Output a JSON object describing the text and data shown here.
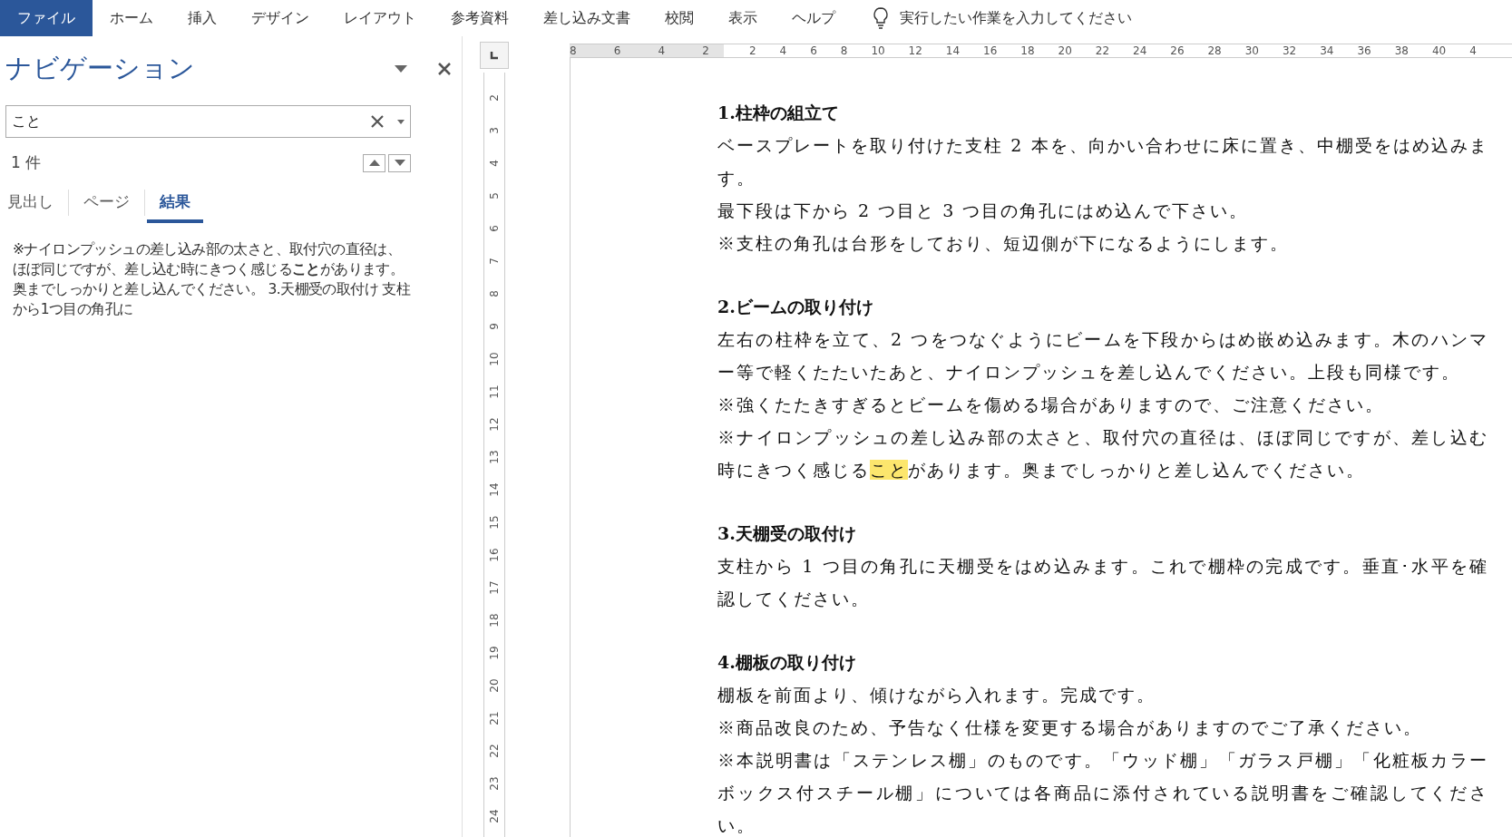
{
  "menu": [
    {
      "label": "ファイル",
      "selected": true
    },
    {
      "label": "ホーム",
      "selected": false
    },
    {
      "label": "挿入",
      "selected": false
    },
    {
      "label": "デザイン",
      "selected": false
    },
    {
      "label": "レイアウト",
      "selected": false
    },
    {
      "label": "参考資料",
      "selected": false
    },
    {
      "label": "差し込み文書",
      "selected": false
    },
    {
      "label": "校閲",
      "selected": false
    },
    {
      "label": "表示",
      "selected": false
    },
    {
      "label": "ヘルプ",
      "selected": false
    }
  ],
  "tell_me": "実行したい作業を入力してください",
  "navigation": {
    "title": "ナビゲーション",
    "search": {
      "value": "こと"
    },
    "result_count": "1 件",
    "tabs": [
      {
        "label": "見出し",
        "selected": false
      },
      {
        "label": "ページ",
        "selected": false
      },
      {
        "label": "結果",
        "selected": true
      }
    ],
    "result": "※ナイロンプッシュの差し込み部の太さと、取付穴の直径は、ほぼ同じですが、差し込む時にきつく感じる**こと**があります。奥までしっかりと差し込んでください。 3.天棚受の取付け 支柱から1つ目の角孔に"
  },
  "ruler": {
    "left_ticks": [
      "8",
      "6",
      "4",
      "2"
    ],
    "right_ticks": [
      "2",
      "4",
      "6",
      "8",
      "10",
      "12",
      "14",
      "16",
      "18",
      "20",
      "22",
      "24",
      "26",
      "28",
      "30",
      "32",
      "34",
      "36",
      "38",
      "40",
      "4"
    ],
    "vertical_ticks": [
      "2",
      "3",
      "4",
      "5",
      "6",
      "7",
      "8",
      "9",
      "10",
      "11",
      "12",
      "13",
      "14",
      "15",
      "16",
      "17",
      "18",
      "19",
      "20",
      "21",
      "22",
      "23",
      "24"
    ]
  },
  "document": [
    {
      "heading": "1.柱枠の組立て",
      "paragraphs": [
        [
          {
            "text": "ベースプレートを取り付けた支柱 2 本を、向かい合わせに床に置き、中棚受をはめ込みます。",
            "highlighted": false
          }
        ],
        [
          {
            "text": "最下段は下から 2 つ目と 3 つ目の角孔にはめ込んで下さい。",
            "highlighted": false
          }
        ],
        [
          {
            "text": "※支柱の角孔は台形をしており、短辺側が下になるようにします。",
            "highlighted": false
          }
        ]
      ]
    },
    {
      "heading": "2.ビームの取り付け",
      "paragraphs": [
        [
          {
            "text": "左右の柱枠を立て、2 つをつなぐようにビームを下段からはめ嵌め込みます。木のハンマー等で軽くたたいたあと、ナイロンプッシュを差し込んでください。上段も同様です。",
            "highlighted": false
          }
        ],
        [
          {
            "text": "※強くたたきすぎるとビームを傷める場合がありますので、ご注意ください。",
            "highlighted": false
          }
        ],
        [
          {
            "text": "※ナイロンプッシュの差し込み部の太さと、取付穴の直径は、ほぼ同じですが、差し込む時にきつく感じる",
            "highlighted": false
          },
          {
            "text": "こと",
            "highlighted": true
          },
          {
            "text": "があります。奥までしっかりと差し込んでください。",
            "highlighted": false
          }
        ]
      ]
    },
    {
      "heading": "3.天棚受の取付け",
      "paragraphs": [
        [
          {
            "text": "支柱から 1 つ目の角孔に天棚受をはめ込みます。これで棚枠の完成です。垂直･水平を確認してください。",
            "highlighted": false
          }
        ]
      ]
    },
    {
      "heading": "4.棚板の取り付け",
      "paragraphs": [
        [
          {
            "text": "棚板を前面より、傾けながら入れます。完成です。",
            "highlighted": false
          }
        ],
        [
          {
            "text": "※商品改良のため、予告なく仕様を変更する場合がありますのでご了承ください。",
            "highlighted": false
          }
        ],
        [
          {
            "text": "※本説明書は「ステンレス棚」のものです。「ウッド棚」「ガラス戸棚」「化粧板カラーボックス付スチール棚」については各商品に添付されている説明書をご確認してください。",
            "highlighted": false
          }
        ]
      ]
    }
  ]
}
